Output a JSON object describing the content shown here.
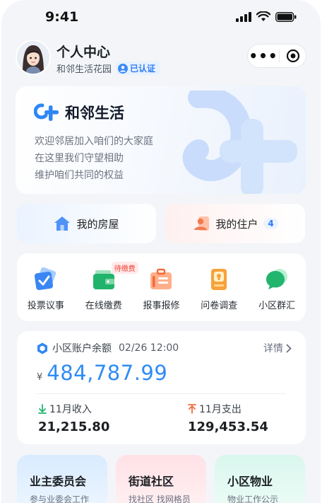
{
  "status_bar": {
    "time": "9:41"
  },
  "header": {
    "title": "个人中心",
    "community": "和邻生活花园",
    "verified_label": "已认证"
  },
  "banner": {
    "brand": "和邻生活",
    "lines": [
      "欢迎邻居加入咱们的大家庭",
      "在这里我们守望相助",
      "维护咱们共同的权益"
    ]
  },
  "quick": {
    "house_label": "我的房屋",
    "resident_label": "我的住户",
    "resident_count": "4"
  },
  "services": [
    {
      "label": "投票议事",
      "icon": "vote-icon"
    },
    {
      "label": "在线缴费",
      "icon": "wallet-icon",
      "badge": "待缴费"
    },
    {
      "label": "报事报修",
      "icon": "toolbox-icon"
    },
    {
      "label": "问卷调查",
      "icon": "survey-icon"
    },
    {
      "label": "小区群汇",
      "icon": "chat-icon"
    }
  ],
  "account": {
    "title": "小区账户余额",
    "datetime": "02/26 12:00",
    "detail_label": "详情",
    "currency": "¥",
    "balance": "484,787.99",
    "income_label": "11月收入",
    "income_value": "21,215.80",
    "expense_label": "11月支出",
    "expense_value": "129,453.54"
  },
  "cards": [
    {
      "title": "业主委员会",
      "subtitle": "参与业委会工作"
    },
    {
      "title": "街道社区",
      "subtitle": "找社区 找网格员"
    },
    {
      "title": "小区物业",
      "subtitle": "物业工作公示"
    }
  ],
  "colors": {
    "accent": "#2f8cf4",
    "background": "#f3f5f8",
    "badge": "#f04438"
  }
}
